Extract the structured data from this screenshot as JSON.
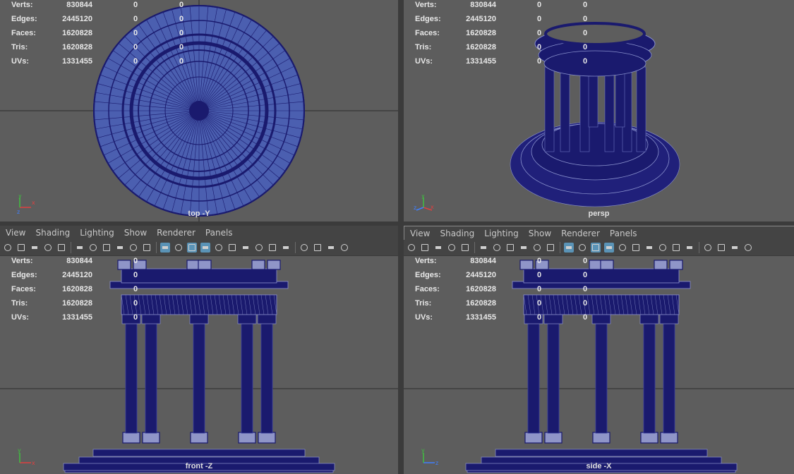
{
  "stats": {
    "rows": [
      {
        "label": "Verts:",
        "value": "830844",
        "sel": "0",
        "tri": "0"
      },
      {
        "label": "Edges:",
        "value": "2445120",
        "sel": "0",
        "tri": "0"
      },
      {
        "label": "Faces:",
        "value": "1620828",
        "sel": "0",
        "tri": "0"
      },
      {
        "label": "Tris:",
        "value": "1620828",
        "sel": "0",
        "tri": "0"
      },
      {
        "label": "UVs:",
        "value": "1331455",
        "sel": "0",
        "tri": "0"
      }
    ]
  },
  "panels": {
    "top": {
      "camera": "top -Y"
    },
    "persp": {
      "camera": "persp"
    },
    "front": {
      "camera": "front -Z"
    },
    "side": {
      "camera": "side -X"
    }
  },
  "menu": {
    "view": "View",
    "shading": "Shading",
    "lighting": "Lighting",
    "show": "Show",
    "renderer": "Renderer",
    "panels": "Panels"
  },
  "axis": {
    "x": "x",
    "y": "y",
    "z": "z"
  },
  "colors": {
    "viewport_bg": "#5d5d5d",
    "wireframe": "#1a1a6e",
    "wire_line": "#9aa0d8",
    "ui_bg": "#444444",
    "active_toggle": "#5a93b6"
  },
  "toolbar_icons": [
    "camera-select-icon",
    "camera-attr-icon",
    "bookmark-icon",
    "image-plane-icon",
    "grid-icon",
    "film-gate-icon",
    "resolution-gate-icon",
    "gate-mask-icon",
    "field-chart-icon",
    "safe-action-icon",
    "safe-title-icon",
    "wireframe-icon",
    "smooth-shade-icon",
    "default-material-icon",
    "textured-icon",
    "lights-icon",
    "shadows-icon",
    "ssao-icon",
    "motion-blur-icon",
    "aa-icon",
    "dof-icon",
    "isolate-icon",
    "xray-icon",
    "xray-joints-icon",
    "backface-icon"
  ]
}
